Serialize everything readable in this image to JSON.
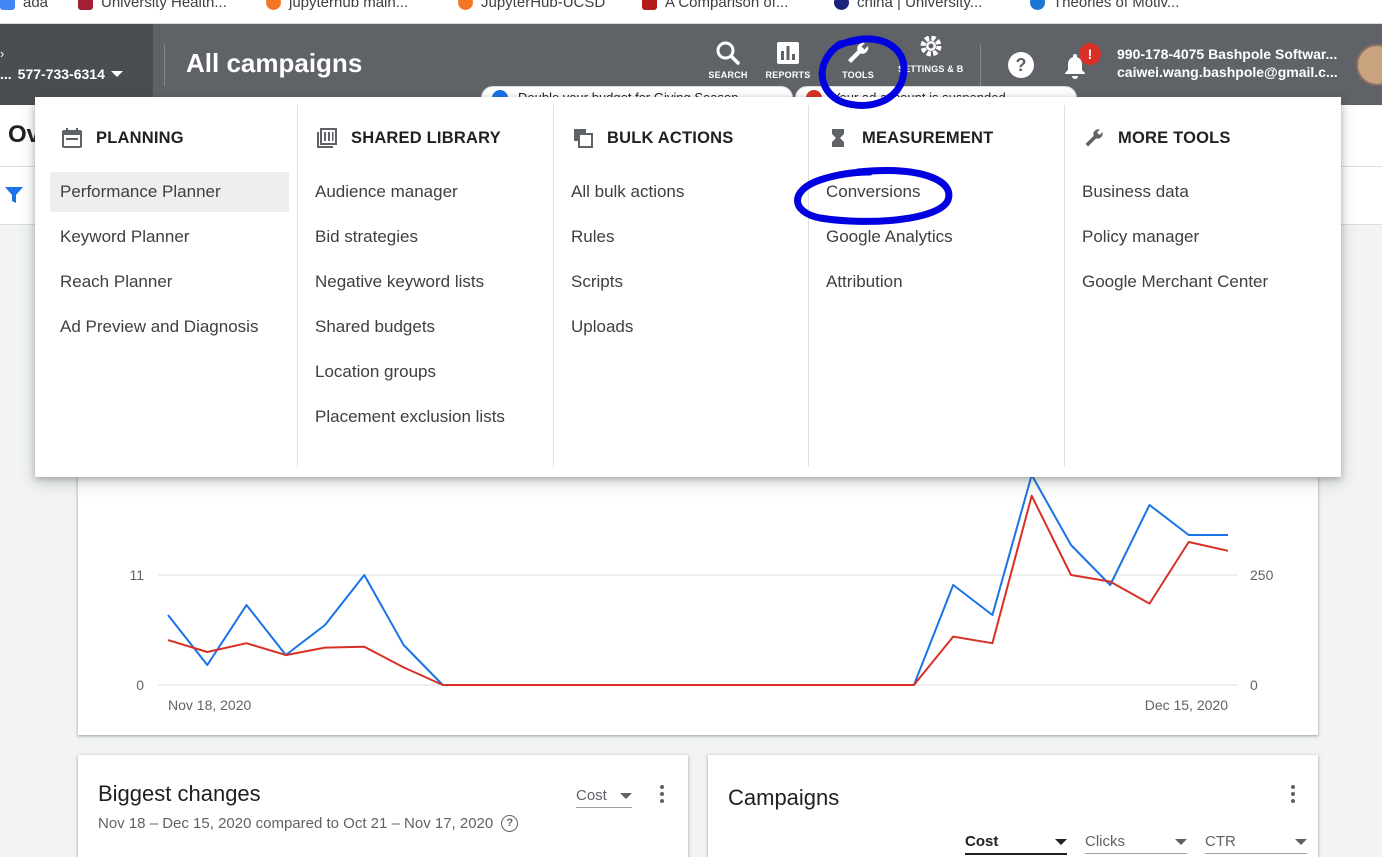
{
  "bookmarks": [
    {
      "label": "ada",
      "color": "#4285f4"
    },
    {
      "label": "University Health...",
      "color": "#a31f34"
    },
    {
      "label": "jupyterhub main...",
      "color": "#f37626"
    },
    {
      "label": "JupyterHub-UCSD",
      "color": "#f37626"
    },
    {
      "label": "A Comparison of...",
      "color": "#b31b1b"
    },
    {
      "label": "china | University...",
      "color": "#1a237e"
    },
    {
      "label": "Theories of Motiv...",
      "color": "#1976d2"
    }
  ],
  "topbar": {
    "account_id": "577-733-6314",
    "page_title": "All campaigns",
    "buttons": {
      "search": "SEARCH",
      "reports": "REPORTS",
      "tools": "TOOLS",
      "settings": "SETTINGS & BILLING"
    },
    "help": "?",
    "notification_badge": "!",
    "account_line1": "990-178-4075 Bashpole Softwar...",
    "account_line2": "caiwei.wang.bashpole@gmail.c..."
  },
  "pills": [
    {
      "text": "Double your budget for Giving Season",
      "dot_color": "#1a73e8"
    },
    {
      "text": "Your ad account is suspended",
      "dot_color": "#d93025"
    }
  ],
  "overview": {
    "title": "Overview"
  },
  "tools_menu": {
    "columns": [
      {
        "heading": "PLANNING",
        "icon": "calendar-icon",
        "items": [
          "Performance Planner",
          "Keyword Planner",
          "Reach Planner",
          "Ad Preview and Diagnosis"
        ],
        "highlighted": 0
      },
      {
        "heading": "SHARED LIBRARY",
        "icon": "library-icon",
        "items": [
          "Audience manager",
          "Bid strategies",
          "Negative keyword lists",
          "Shared budgets",
          "Location groups",
          "Placement exclusion lists"
        ]
      },
      {
        "heading": "BULK ACTIONS",
        "icon": "copy-icon",
        "items": [
          "All bulk actions",
          "Rules",
          "Scripts",
          "Uploads"
        ]
      },
      {
        "heading": "MEASUREMENT",
        "icon": "hourglass-icon",
        "items": [
          "Conversions",
          "Google Analytics",
          "Attribution"
        ]
      },
      {
        "heading": "MORE TOOLS",
        "icon": "wrench-icon",
        "items": [
          "Business data",
          "Policy manager",
          "Google Merchant Center"
        ]
      }
    ]
  },
  "chart_data": {
    "type": "line",
    "x_start_label": "Nov 18, 2020",
    "x_end_label": "Dec 15, 2020",
    "left_axis_ticks": [
      "11",
      "0"
    ],
    "right_axis_ticks": [
      "250",
      "0"
    ],
    "left_ylim": [
      0,
      11
    ],
    "right_ylim": [
      0,
      250
    ],
    "series": [
      {
        "color": "#1a73e8",
        "axis": "left",
        "values": [
          7,
          2,
          8,
          3,
          6,
          11,
          4,
          0,
          0,
          0,
          0,
          0,
          0,
          0,
          0,
          0,
          0,
          0,
          0,
          0,
          10,
          7,
          21,
          14,
          10,
          18,
          15,
          15
        ]
      },
      {
        "color": "#d93025",
        "axis": "right",
        "values": [
          102,
          75,
          95,
          68,
          85,
          87,
          40,
          0,
          0,
          0,
          0,
          0,
          0,
          0,
          0,
          0,
          0,
          0,
          0,
          0,
          110,
          95,
          430,
          250,
          235,
          185,
          325,
          305
        ]
      }
    ]
  },
  "biggest_changes": {
    "title": "Biggest changes",
    "metric": "Cost",
    "subtitle": "Nov 18 – Dec 15, 2020 compared to Oct 21 – Nov 17, 2020"
  },
  "campaigns": {
    "title": "Campaigns",
    "metrics": [
      "Cost",
      "Clicks",
      "CTR"
    ]
  },
  "colors": {
    "topbar": "#5f6368",
    "accent_blue": "#1a73e8",
    "accent_red": "#d93025",
    "annotation_marker": "#0000e0"
  }
}
